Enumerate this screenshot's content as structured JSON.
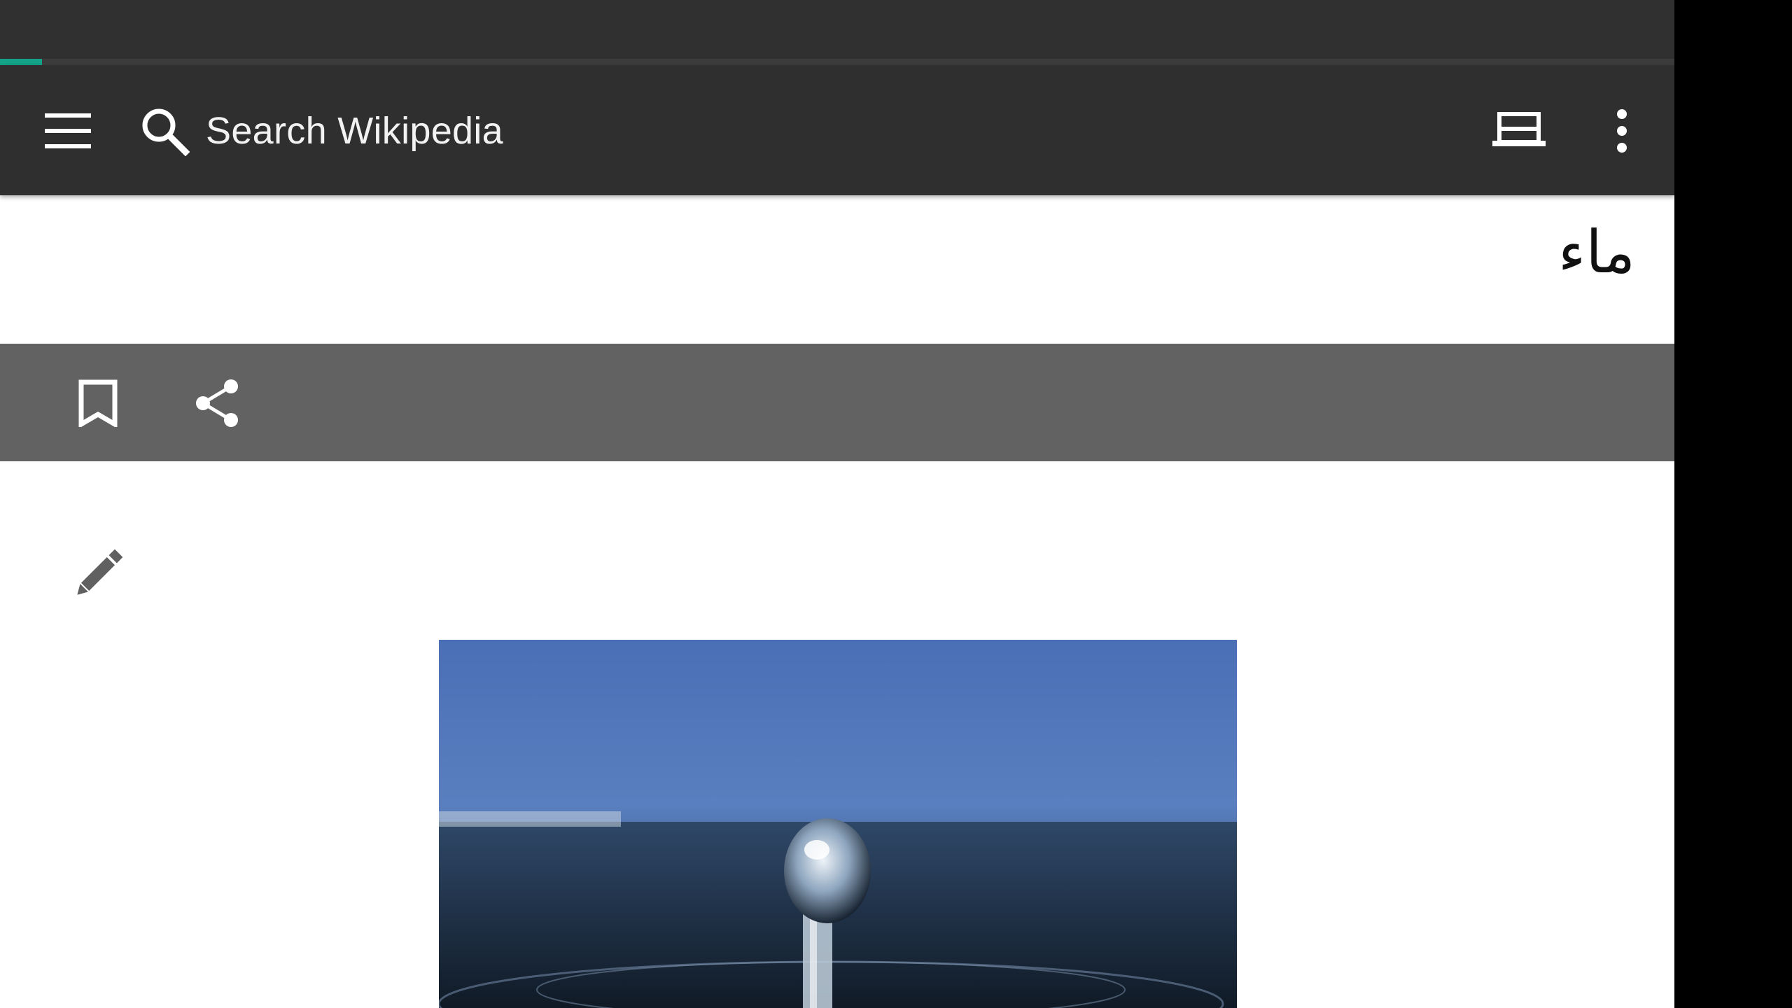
{
  "app": {
    "name": "Wikipedia"
  },
  "status_bar": {
    "color": "#303030"
  },
  "progress": {
    "value_percent": 2.5,
    "color": "#14a289"
  },
  "toolbar": {
    "menu_icon": "hamburger-menu-icon",
    "search_icon": "search-icon",
    "search_placeholder": "Search Wikipedia",
    "reading_list_icon": "reading-list-icon",
    "overflow_icon": "more-vert-icon",
    "background": "#2f2f2f"
  },
  "article": {
    "title": "ماء"
  },
  "action_bar": {
    "bookmark_icon": "bookmark-icon",
    "share_icon": "share-icon",
    "background": "#626262"
  },
  "content": {
    "edit_icon": "pencil-edit-icon",
    "lead_image": "water-droplet-image"
  }
}
